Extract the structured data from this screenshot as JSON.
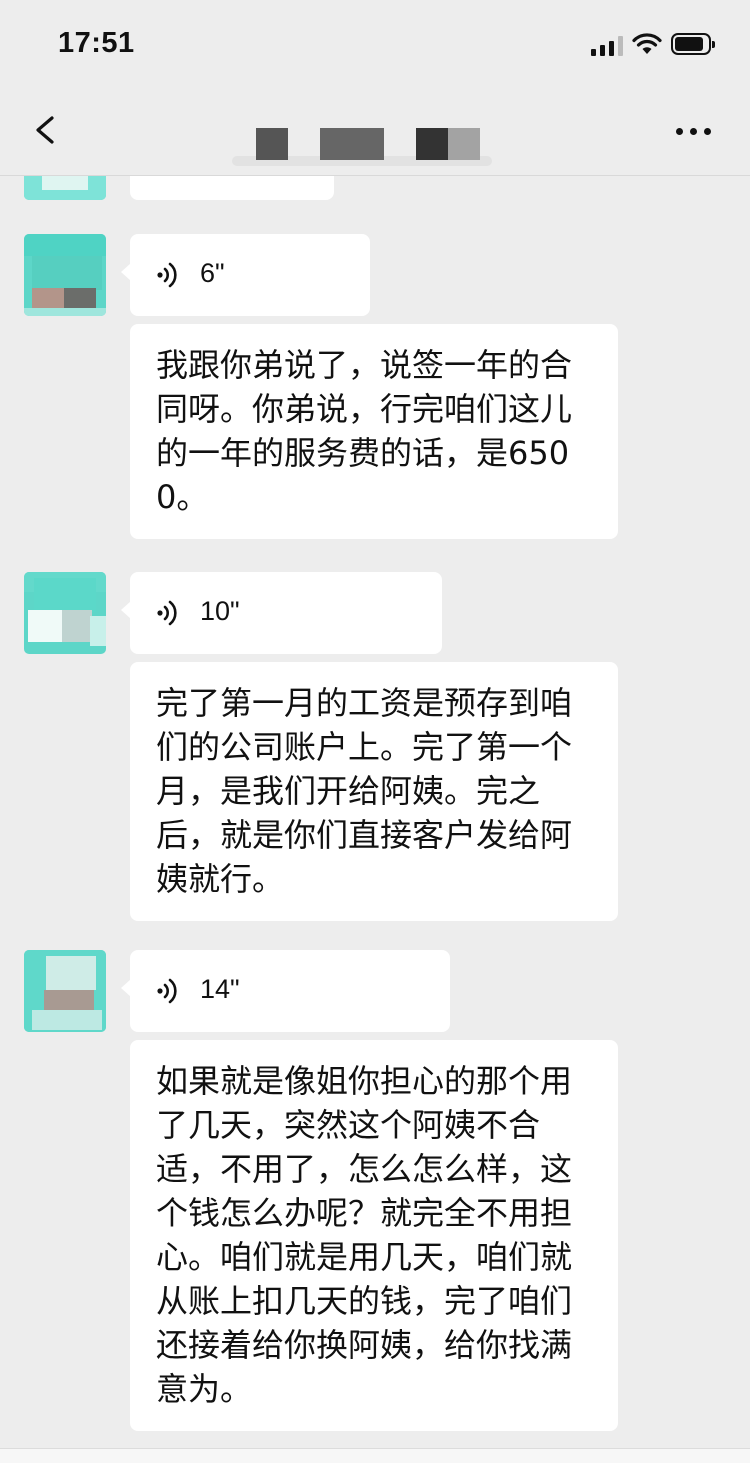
{
  "status_bar": {
    "time": "17:51"
  },
  "nav": {
    "title": ""
  },
  "messages": [
    {
      "type": "voice",
      "duration": "6\""
    },
    {
      "type": "text",
      "text": "我跟你弟说了，说签一年的合同呀。你弟说，行完咱们这儿的一年的服务费的话，是6500。"
    },
    {
      "type": "voice",
      "duration": "10\""
    },
    {
      "type": "text",
      "text": "完了第一月的工资是预存到咱们的公司账户上。完了第一个月，是我们开给阿姨。完之后，就是你们直接客户发给阿姨就行。"
    },
    {
      "type": "voice",
      "duration": "14\""
    },
    {
      "type": "text",
      "text": "如果就是像姐你担心的那个用了几天，突然这个阿姨不合适，不用了，怎么怎么样，这个钱怎么办呢？就完全不用担心。咱们就是用几天，咱们就从账上扣几天的钱，完了咱们还接着给你换阿姨，给你找满意为。"
    }
  ],
  "icons": [
    "back-arrow-icon",
    "more-icon",
    "voice-wave-icon",
    "signal-icon",
    "wifi-icon",
    "battery-icon"
  ]
}
